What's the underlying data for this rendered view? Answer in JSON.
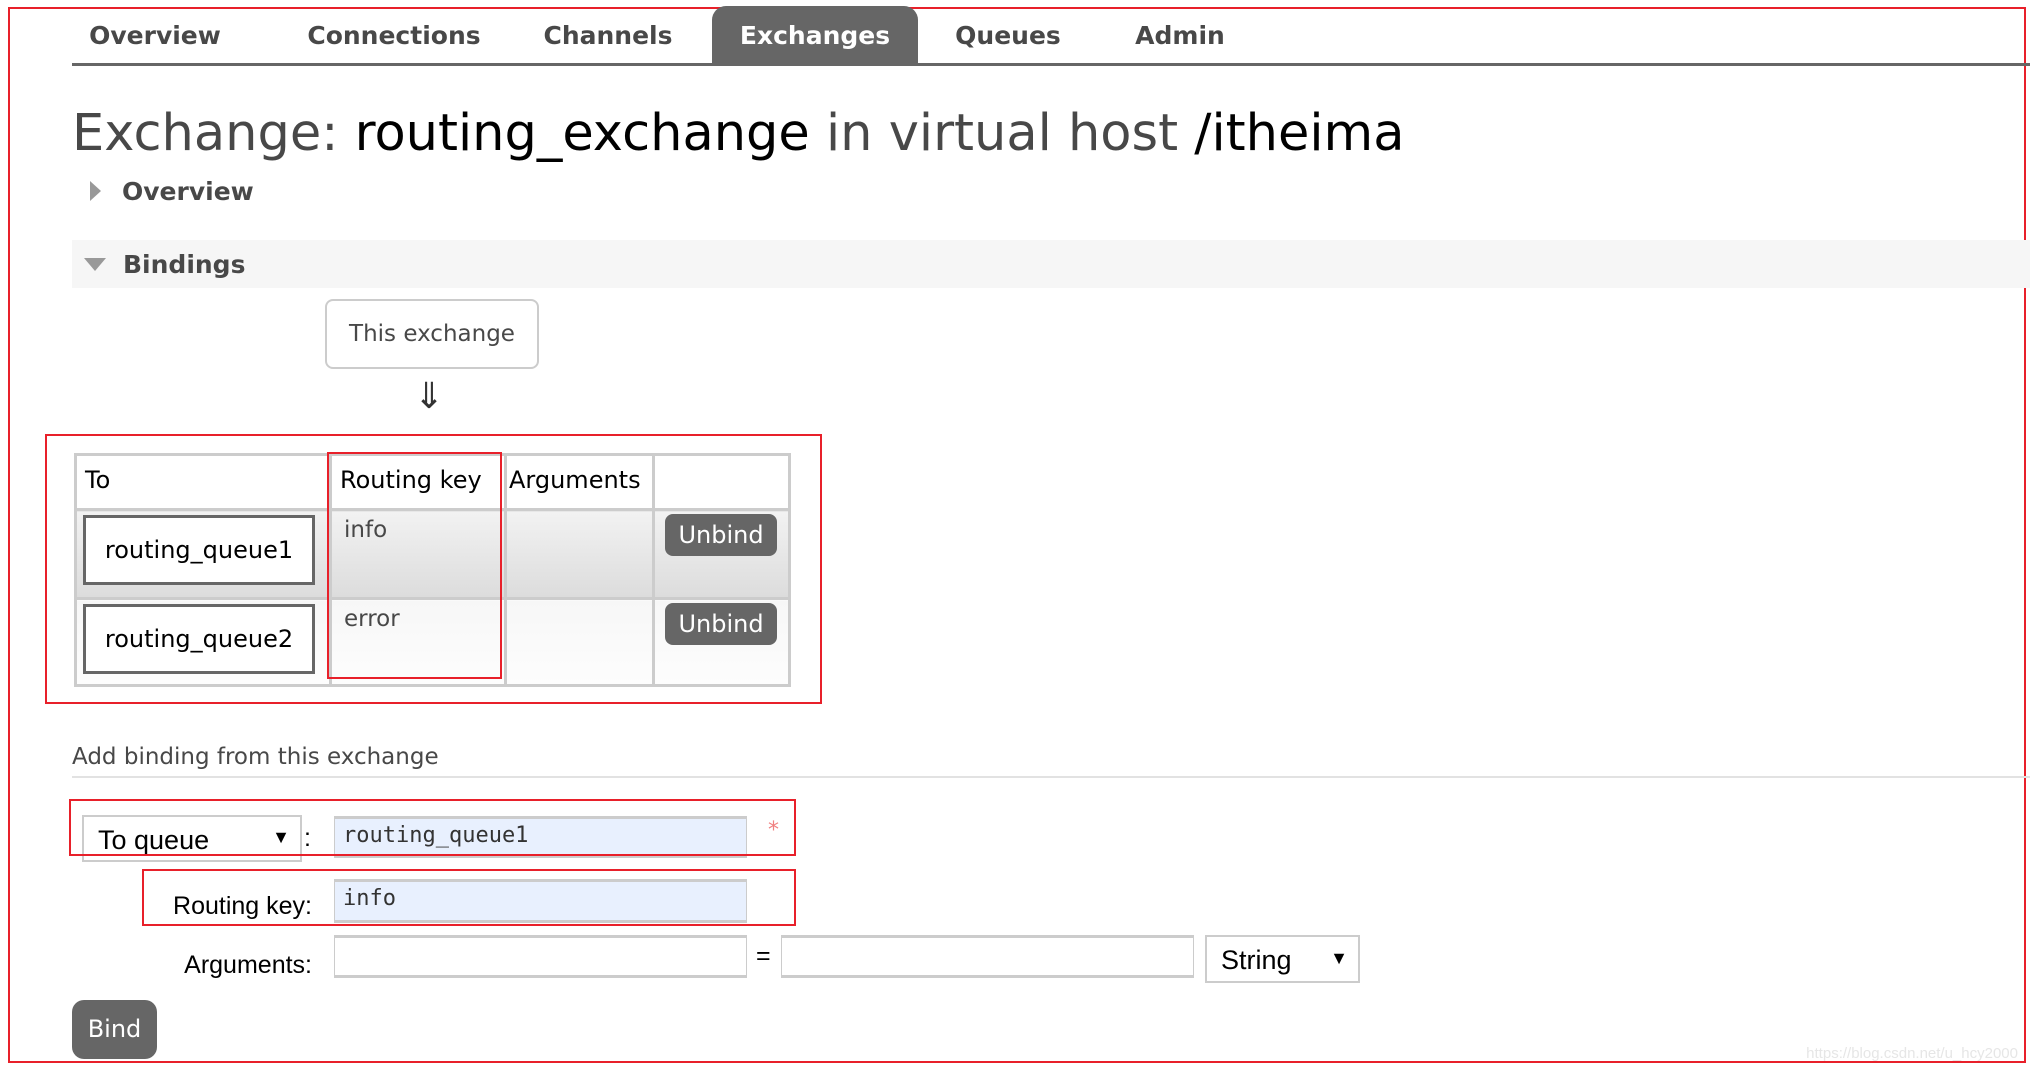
{
  "nav": {
    "tabs": [
      {
        "label": "Overview"
      },
      {
        "label": "Connections"
      },
      {
        "label": "Channels"
      },
      {
        "label": "Exchanges",
        "active": true
      },
      {
        "label": "Queues"
      },
      {
        "label": "Admin"
      }
    ]
  },
  "header": {
    "prefix": "Exchange: ",
    "exchange_name": "routing_exchange",
    "middle": " in virtual host ",
    "vhost": "/itheima"
  },
  "sections": {
    "overview": "Overview",
    "bindings": "Bindings"
  },
  "bindings": {
    "source_label": "This exchange",
    "arrow": "⇓",
    "columns": [
      "To",
      "Routing key",
      "Arguments",
      ""
    ],
    "rows": [
      {
        "to": "routing_queue1",
        "routing_key": "info",
        "arguments": "",
        "action": "Unbind"
      },
      {
        "to": "routing_queue2",
        "routing_key": "error",
        "arguments": "",
        "action": "Unbind"
      }
    ]
  },
  "add_binding": {
    "heading": "Add binding from this exchange",
    "destination_type": "To queue",
    "colon": ":",
    "destination_value": "routing_queue1",
    "required_marker": "*",
    "routing_key_label": "Routing key:",
    "routing_key_value": "info",
    "arguments_label": "Arguments:",
    "argument_key": "",
    "equals": "=",
    "argument_value": "",
    "argument_type": "String",
    "bind_label": "Bind"
  },
  "watermark": "https://blog.csdn.net/u_hcy2000",
  "colors": {
    "annotation_red": "#e8202a",
    "tab_active": "#666666",
    "input_bg": "#e8f0fe"
  }
}
